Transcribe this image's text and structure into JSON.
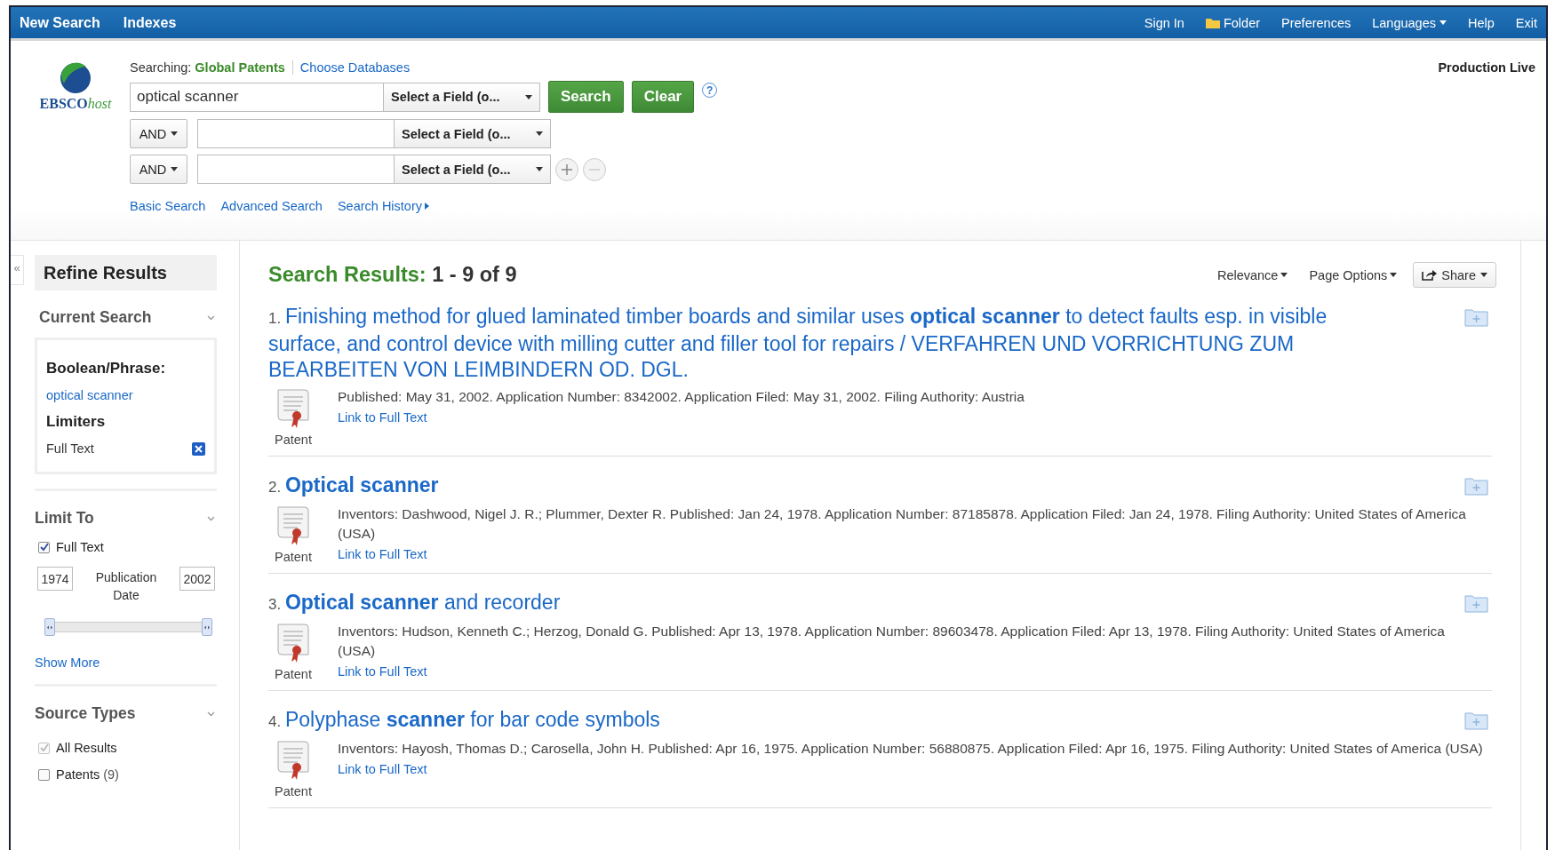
{
  "top_nav": {
    "left": [
      "New Search",
      "Indexes"
    ],
    "right": [
      {
        "label": "Sign In",
        "kind": "link"
      },
      {
        "label": "Folder",
        "kind": "folder"
      },
      {
        "label": "Preferences",
        "kind": "link"
      },
      {
        "label": "Languages",
        "kind": "menu"
      },
      {
        "label": "Help",
        "kind": "link"
      },
      {
        "label": "Exit",
        "kind": "link"
      }
    ]
  },
  "search": {
    "logo": {
      "name": "EBSCO",
      "suffix": "host"
    },
    "searching_label": "Searching:",
    "database": "Global Patents",
    "choose_databases": "Choose Databases",
    "environment": "Production Live",
    "rows": [
      {
        "operator": null,
        "value": "optical scanner",
        "field": "Select a Field (o..."
      },
      {
        "operator": "AND",
        "value": "",
        "field": "Select a Field (o..."
      },
      {
        "operator": "AND",
        "value": "",
        "field": "Select a Field (o..."
      }
    ],
    "buttons": [
      "Search",
      "Clear"
    ],
    "help": "?",
    "links": [
      {
        "label": "Basic Search",
        "menu": false
      },
      {
        "label": "Advanced Search",
        "menu": false
      },
      {
        "label": "Search History",
        "menu": true
      }
    ]
  },
  "sidebar": {
    "collapse": "«",
    "title": "Refine Results",
    "current_search": {
      "title": "Current Search",
      "boolean_label": "Boolean/Phrase:",
      "query": "optical scanner",
      "limiters_label": "Limiters",
      "limiters": [
        {
          "label": "Full Text"
        }
      ]
    },
    "limit_to": {
      "title": "Limit To",
      "options": [
        {
          "label": "Full Text",
          "checked": true,
          "disabled": false
        }
      ],
      "date_from": "1974",
      "date_to": "2002",
      "date_label": "Publication Date",
      "slider": {
        "thumbs": [
          {
            "level": 0
          },
          {
            "level": 1
          }
        ]
      },
      "show_more": "Show More"
    },
    "source_types": {
      "title": "Source Types",
      "options": [
        {
          "label": "All Results",
          "checked": true,
          "disabled": true
        },
        {
          "label": "Patents",
          "count": "(9)",
          "checked": false,
          "disabled": false
        }
      ]
    }
  },
  "results": {
    "heading": "Search Results:",
    "range": "1 - 9 of 9",
    "tools": [
      {
        "label": "Relevance",
        "kind": "menu"
      },
      {
        "label": "Page Options",
        "kind": "menu"
      },
      {
        "label": "Share",
        "kind": "button"
      }
    ],
    "items": [
      {
        "number": "1.",
        "title": "Finishing method for glued laminated timber boards and similar uses **optical scanner** to detect faults esp. in visible surface, and control device with milling cutter and filler tool for repairs / VERFAHREN UND VORRICHTUNG ZUM BEARBEITEN VON LEIMBINDERN OD. DGL.",
        "meta": "Published: May 31, 2002. Application Number: 8342002. Application Filed: May 31, 2002. Filing Authority: Austria",
        "link": "Link to Full Text",
        "type": "Patent"
      },
      {
        "number": "2.",
        "title": "**Optical scanner**",
        "meta": "Inventors: Dashwood, Nigel J. R.; Plummer, Dexter R. Published: Jan 24, 1978. Application Number: 87185878. Application Filed: Jan 24, 1978. Filing Authority: United States of America (USA)",
        "link": "Link to Full Text",
        "type": "Patent"
      },
      {
        "number": "3.",
        "title": "**Optical scanner** and recorder",
        "meta": "Inventors: Hudson, Kenneth C.; Herzog, Donald G. Published: Apr 13, 1978. Application Number: 89603478. Application Filed: Apr 13, 1978. Filing Authority: United States of America (USA)",
        "link": "Link to Full Text",
        "type": "Patent"
      },
      {
        "number": "4.",
        "title": "Polyphase **scanner** for bar code symbols",
        "meta": "Inventors: Hayosh, Thomas D.; Carosella, John H. Published: Apr 16, 1975. Application Number: 56880875. Application Filed: Apr 16, 1975. Filing Authority: United States of America (USA)",
        "link": "Link to Full Text",
        "type": "Patent"
      }
    ]
  }
}
